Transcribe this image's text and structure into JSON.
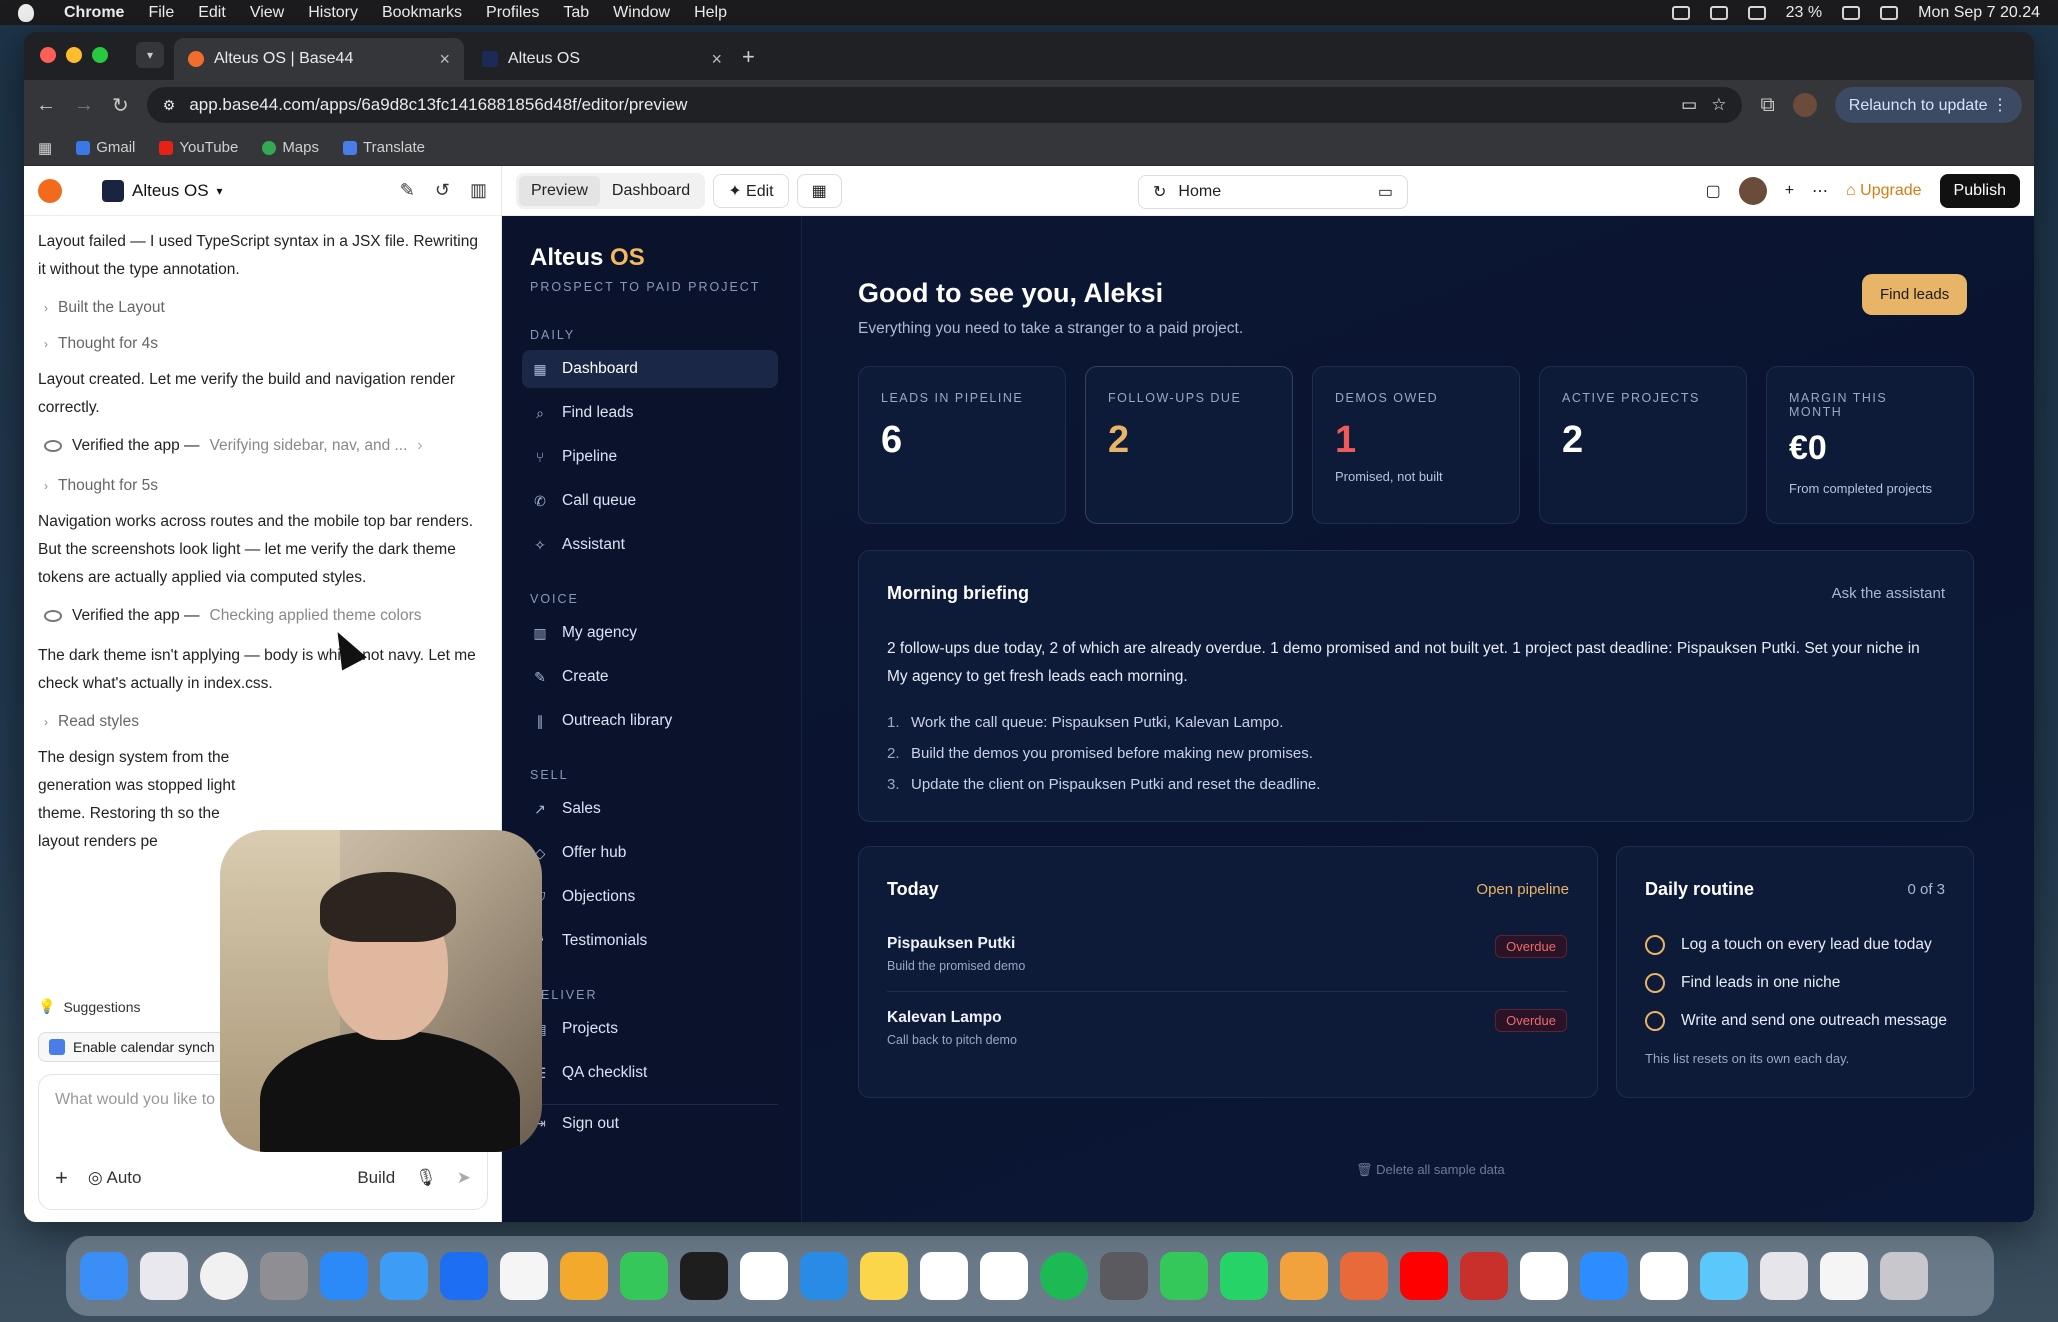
{
  "menubar": {
    "app": "Chrome",
    "items": [
      "File",
      "Edit",
      "View",
      "History",
      "Bookmarks",
      "Profiles",
      "Tab",
      "Window",
      "Help"
    ],
    "battery": "23 %",
    "clock": "Mon Sep 7  20.24"
  },
  "browser": {
    "tabs": [
      {
        "title": "Alteus OS | Base44",
        "active": true
      },
      {
        "title": "Alteus OS",
        "active": false
      }
    ],
    "url": "app.base44.com/apps/6a9d8c13fc1416881856d48f/editor/preview",
    "relaunch": "Relaunch to update",
    "bookmarks": [
      "Gmail",
      "YouTube",
      "Maps",
      "Translate"
    ]
  },
  "chat": {
    "project": "Alteus OS",
    "messages": {
      "m1": "Layout failed — I used TypeScript syntax in a JSX file. Rewriting it without the type annotation.",
      "s1": "Built the Layout",
      "s2": "Thought for 4s",
      "m2": "Layout created. Let me verify the build and navigation render correctly.",
      "v1": "Verified the app —",
      "v1sub": "Verifying sidebar, nav, and ...",
      "s3": "Thought for 5s",
      "m3": "Navigation works across routes and the mobile top bar renders. But the screenshots look light — let me verify the dark theme tokens are actually applied via computed styles.",
      "v2": "Verified the app —",
      "v2sub": "Checking applied theme colors",
      "m4": "The dark theme isn't applying — body is white, not navy. Let me check what's actually in index.css.",
      "s4": "Read styles",
      "m5": "The design system from the generation was stopped light theme. Restoring th so the layout renders pe"
    },
    "suggestions_label": "Suggestions",
    "suggestion_chip": "Enable calendar synch",
    "input_placeholder": "What would you like to",
    "mode": "Auto",
    "build": "Build"
  },
  "builder": {
    "preview": "Preview",
    "dashboard": "Dashboard",
    "edit": "Edit",
    "route": "Home",
    "upgrade": "Upgrade",
    "publish": "Publish"
  },
  "app": {
    "brand_main": "Alteus",
    "brand_accent": "OS",
    "brand_sub": "PROSPECT TO PAID PROJECT",
    "sections": {
      "daily": "DAILY",
      "voice": "VOICE",
      "sell": "SELL",
      "deliver": "DELIVER"
    },
    "nav": {
      "dashboard": "Dashboard",
      "find_leads": "Find leads",
      "pipeline": "Pipeline",
      "call_queue": "Call queue",
      "assistant": "Assistant",
      "my_agency": "My agency",
      "create": "Create",
      "outreach": "Outreach library",
      "sales": "Sales",
      "offer_hub": "Offer hub",
      "objections": "Objections",
      "testimonials": "Testimonials",
      "projects": "Projects",
      "qa": "QA checklist",
      "sign_out": "Sign out"
    },
    "greeting": "Good to see you, Aleksi",
    "greeting_sub": "Everything you need to take a stranger to a paid project.",
    "find_leads_btn": "Find leads",
    "stats": [
      {
        "label": "LEADS IN PIPELINE",
        "value": "6",
        "caption": "",
        "color": "#ffffff"
      },
      {
        "label": "FOLLOW-UPS DUE",
        "value": "2",
        "caption": "",
        "color": "#e8b468"
      },
      {
        "label": "DEMOS OWED",
        "value": "1",
        "caption": "Promised, not built",
        "color": "#ef5a5a"
      },
      {
        "label": "ACTIVE PROJECTS",
        "value": "2",
        "caption": "",
        "color": "#ffffff"
      },
      {
        "label": "MARGIN THIS MONTH",
        "value": "€0",
        "caption": "From completed projects",
        "color": "#ffffff"
      }
    ],
    "briefing": {
      "title": "Morning briefing",
      "link": "Ask the assistant",
      "text": "2 follow-ups due today, 2 of which are already overdue. 1 demo promised and not built yet. 1 project past deadline: Pispauksen Putki. Set your niche in My agency to get fresh leads each morning.",
      "items": [
        "Work the call queue: Pispauksen Putki, Kalevan Lampo.",
        "Build the demos you promised before making new promises.",
        "Update the client on Pispauksen Putki and reset the deadline."
      ]
    },
    "today": {
      "title": "Today",
      "link": "Open pipeline",
      "leads": [
        {
          "name": "Pispauksen Putki",
          "desc": "Build the promised demo",
          "badge": "Overdue"
        },
        {
          "name": "Kalevan Lampo",
          "desc": "Call back to pitch demo",
          "badge": "Overdue"
        }
      ]
    },
    "routine": {
      "title": "Daily routine",
      "count": "0 of 3",
      "items": [
        "Log a touch on every lead due today",
        "Find leads in one niche",
        "Write and send one outreach message"
      ],
      "footer": "This list resets on its own each day."
    },
    "delete_sample": "Delete all sample data"
  }
}
